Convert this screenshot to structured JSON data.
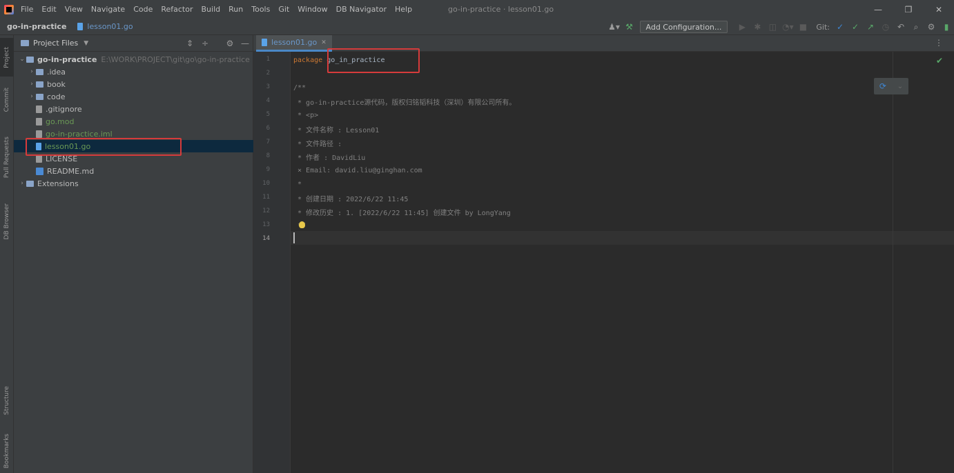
{
  "menubar": {
    "items": [
      "File",
      "Edit",
      "View",
      "Navigate",
      "Code",
      "Refactor",
      "Build",
      "Run",
      "Tools",
      "Git",
      "Window",
      "DB Navigator",
      "Help"
    ],
    "window_title": "go-in-practice · lesson01.go"
  },
  "window_controls": {
    "minimize": "—",
    "restore": "❐",
    "close": "✕"
  },
  "navbar": {
    "project": "go-in-practice",
    "file": "lesson01.go",
    "config_label": "Add Configuration...",
    "git_label": "Git:"
  },
  "left_strip": [
    "Project",
    "Commit",
    "Pull Requests",
    "DB Browser",
    "Structure",
    "Bookmarks"
  ],
  "project_panel": {
    "title": "Project Files",
    "tree": {
      "root_name": "go-in-practice",
      "root_path": "E:\\WORK\\PROJECT\\git\\go\\go-in-practice",
      "idea": ".idea",
      "book": "book",
      "code": "code",
      "gitignore": ".gitignore",
      "gomod": "go.mod",
      "iml": "go-in-practice.iml",
      "lesson": "lesson01.go",
      "license": "LICENSE",
      "readme": "README.md",
      "extensions": "Extensions"
    }
  },
  "editor": {
    "tab_label": "lesson01.go",
    "line_numbers": [
      "1",
      "2",
      "3",
      "4",
      "5",
      "6",
      "7",
      "8",
      "9",
      "10",
      "11",
      "12",
      "13",
      "14"
    ],
    "code": {
      "l1_kw": "package",
      "l1_name": "go_in_practice",
      "l3": "/**",
      "l4": " * go-in-practice源代码，版权归铭韬科技（深圳）有限公司所有。",
      "l5": " * <p>",
      "l6": " * 文件名称 : Lesson01",
      "l7": " * 文件路径 :",
      "l8": " * 作者 : DavidLiu",
      "l9": " × Email: david.liu@ginghan.com",
      "l10": " *",
      "l11": " * 创建日期 : 2022/6/22 11:45",
      "l12": " * 修改历史 : 1. [2022/6/22 11:45] 创建文件 by LongYang",
      "l13": " */"
    }
  },
  "colors": {
    "highlight": "#d63b3b",
    "selection": "#0d293e",
    "accent": "#4a88c7"
  }
}
